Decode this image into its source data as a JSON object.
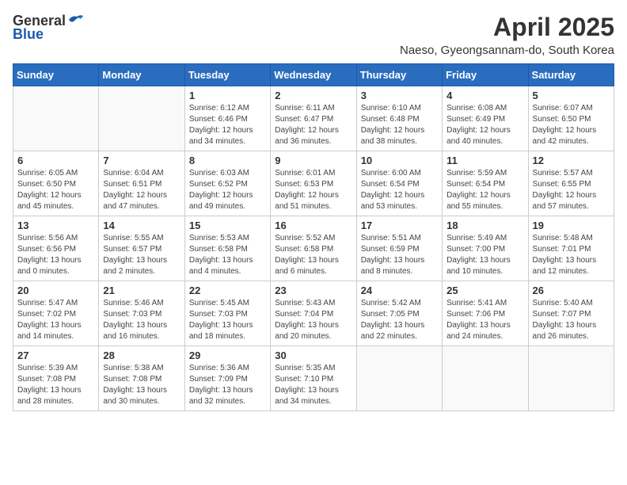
{
  "logo": {
    "general": "General",
    "blue": "Blue"
  },
  "title": "April 2025",
  "subtitle": "Naeso, Gyeongsannam-do, South Korea",
  "days_of_week": [
    "Sunday",
    "Monday",
    "Tuesday",
    "Wednesday",
    "Thursday",
    "Friday",
    "Saturday"
  ],
  "weeks": [
    [
      {
        "day": "",
        "info": ""
      },
      {
        "day": "",
        "info": ""
      },
      {
        "day": "1",
        "info": "Sunrise: 6:12 AM\nSunset: 6:46 PM\nDaylight: 12 hours and 34 minutes."
      },
      {
        "day": "2",
        "info": "Sunrise: 6:11 AM\nSunset: 6:47 PM\nDaylight: 12 hours and 36 minutes."
      },
      {
        "day": "3",
        "info": "Sunrise: 6:10 AM\nSunset: 6:48 PM\nDaylight: 12 hours and 38 minutes."
      },
      {
        "day": "4",
        "info": "Sunrise: 6:08 AM\nSunset: 6:49 PM\nDaylight: 12 hours and 40 minutes."
      },
      {
        "day": "5",
        "info": "Sunrise: 6:07 AM\nSunset: 6:50 PM\nDaylight: 12 hours and 42 minutes."
      }
    ],
    [
      {
        "day": "6",
        "info": "Sunrise: 6:05 AM\nSunset: 6:50 PM\nDaylight: 12 hours and 45 minutes."
      },
      {
        "day": "7",
        "info": "Sunrise: 6:04 AM\nSunset: 6:51 PM\nDaylight: 12 hours and 47 minutes."
      },
      {
        "day": "8",
        "info": "Sunrise: 6:03 AM\nSunset: 6:52 PM\nDaylight: 12 hours and 49 minutes."
      },
      {
        "day": "9",
        "info": "Sunrise: 6:01 AM\nSunset: 6:53 PM\nDaylight: 12 hours and 51 minutes."
      },
      {
        "day": "10",
        "info": "Sunrise: 6:00 AM\nSunset: 6:54 PM\nDaylight: 12 hours and 53 minutes."
      },
      {
        "day": "11",
        "info": "Sunrise: 5:59 AM\nSunset: 6:54 PM\nDaylight: 12 hours and 55 minutes."
      },
      {
        "day": "12",
        "info": "Sunrise: 5:57 AM\nSunset: 6:55 PM\nDaylight: 12 hours and 57 minutes."
      }
    ],
    [
      {
        "day": "13",
        "info": "Sunrise: 5:56 AM\nSunset: 6:56 PM\nDaylight: 13 hours and 0 minutes."
      },
      {
        "day": "14",
        "info": "Sunrise: 5:55 AM\nSunset: 6:57 PM\nDaylight: 13 hours and 2 minutes."
      },
      {
        "day": "15",
        "info": "Sunrise: 5:53 AM\nSunset: 6:58 PM\nDaylight: 13 hours and 4 minutes."
      },
      {
        "day": "16",
        "info": "Sunrise: 5:52 AM\nSunset: 6:58 PM\nDaylight: 13 hours and 6 minutes."
      },
      {
        "day": "17",
        "info": "Sunrise: 5:51 AM\nSunset: 6:59 PM\nDaylight: 13 hours and 8 minutes."
      },
      {
        "day": "18",
        "info": "Sunrise: 5:49 AM\nSunset: 7:00 PM\nDaylight: 13 hours and 10 minutes."
      },
      {
        "day": "19",
        "info": "Sunrise: 5:48 AM\nSunset: 7:01 PM\nDaylight: 13 hours and 12 minutes."
      }
    ],
    [
      {
        "day": "20",
        "info": "Sunrise: 5:47 AM\nSunset: 7:02 PM\nDaylight: 13 hours and 14 minutes."
      },
      {
        "day": "21",
        "info": "Sunrise: 5:46 AM\nSunset: 7:03 PM\nDaylight: 13 hours and 16 minutes."
      },
      {
        "day": "22",
        "info": "Sunrise: 5:45 AM\nSunset: 7:03 PM\nDaylight: 13 hours and 18 minutes."
      },
      {
        "day": "23",
        "info": "Sunrise: 5:43 AM\nSunset: 7:04 PM\nDaylight: 13 hours and 20 minutes."
      },
      {
        "day": "24",
        "info": "Sunrise: 5:42 AM\nSunset: 7:05 PM\nDaylight: 13 hours and 22 minutes."
      },
      {
        "day": "25",
        "info": "Sunrise: 5:41 AM\nSunset: 7:06 PM\nDaylight: 13 hours and 24 minutes."
      },
      {
        "day": "26",
        "info": "Sunrise: 5:40 AM\nSunset: 7:07 PM\nDaylight: 13 hours and 26 minutes."
      }
    ],
    [
      {
        "day": "27",
        "info": "Sunrise: 5:39 AM\nSunset: 7:08 PM\nDaylight: 13 hours and 28 minutes."
      },
      {
        "day": "28",
        "info": "Sunrise: 5:38 AM\nSunset: 7:08 PM\nDaylight: 13 hours and 30 minutes."
      },
      {
        "day": "29",
        "info": "Sunrise: 5:36 AM\nSunset: 7:09 PM\nDaylight: 13 hours and 32 minutes."
      },
      {
        "day": "30",
        "info": "Sunrise: 5:35 AM\nSunset: 7:10 PM\nDaylight: 13 hours and 34 minutes."
      },
      {
        "day": "",
        "info": ""
      },
      {
        "day": "",
        "info": ""
      },
      {
        "day": "",
        "info": ""
      }
    ]
  ]
}
